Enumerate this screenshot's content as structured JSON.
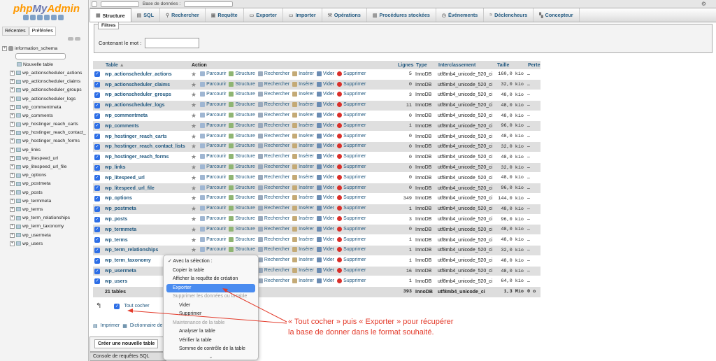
{
  "sidebar": {
    "logo_php": "php",
    "logo_my": "My",
    "logo_admin": "Admin",
    "tab_recent": "Récentes",
    "tab_favorites": "Préférées",
    "db_name": "information_schema",
    "new_table": "Nouvelle table",
    "tables": [
      "wp_actionscheduler_actions",
      "wp_actionscheduler_claims",
      "wp_actionscheduler_groups",
      "wp_actionscheduler_logs",
      "wp_commentmeta",
      "wp_comments",
      "wp_hostinger_reach_carts",
      "wp_hostinger_reach_contact_",
      "wp_hostinger_reach_forms",
      "wp_links",
      "wp_litespeed_url",
      "wp_litespeed_url_file",
      "wp_options",
      "wp_postmeta",
      "wp_posts",
      "wp_termmeta",
      "wp_terms",
      "wp_term_relationships",
      "wp_term_taxonomy",
      "wp_usermeta",
      "wp_users"
    ]
  },
  "topbar": {
    "db_label": "Base de données :"
  },
  "tabs": [
    {
      "label": "Structure",
      "icon": "structure-icon",
      "active": true
    },
    {
      "label": "SQL",
      "icon": "sql-icon"
    },
    {
      "label": "Rechercher",
      "icon": "search-icon"
    },
    {
      "label": "Requête",
      "icon": "query-icon"
    },
    {
      "label": "Exporter",
      "icon": "export-icon"
    },
    {
      "label": "Importer",
      "icon": "import-icon"
    },
    {
      "label": "Opérations",
      "icon": "wrench-icon"
    },
    {
      "label": "Procédures stockées",
      "icon": "routines-icon"
    },
    {
      "label": "Événements",
      "icon": "clock-icon"
    },
    {
      "label": "Déclencheurs",
      "icon": "triggers-icon"
    },
    {
      "label": "Concepteur",
      "icon": "designer-icon"
    }
  ],
  "filters": {
    "legend": "Filtres",
    "label": "Contenant le mot :",
    "value": ""
  },
  "table": {
    "headers": {
      "table": "Table",
      "action": "Action",
      "rows": "Lignes",
      "type": "Type",
      "collation": "Interclassement",
      "size": "Taille",
      "overhead": "Perte"
    },
    "actions": {
      "browse": "Parcourir",
      "structure": "Structure",
      "search": "Rechercher",
      "insert": "Insérer",
      "empty": "Vider",
      "drop": "Supprimer"
    },
    "rows": [
      {
        "name": "wp_actionscheduler_actions",
        "rows": "5",
        "type": "InnoDB",
        "collation": "utf8mb4_unicode_520_ci",
        "size": "160,0 kio",
        "overhead": "–"
      },
      {
        "name": "wp_actionscheduler_claims",
        "rows": "0",
        "type": "InnoDB",
        "collation": "utf8mb4_unicode_520_ci",
        "size": "32,0 kio",
        "overhead": "–"
      },
      {
        "name": "wp_actionscheduler_groups",
        "rows": "3",
        "type": "InnoDB",
        "collation": "utf8mb4_unicode_520_ci",
        "size": "48,0 kio",
        "overhead": "–"
      },
      {
        "name": "wp_actionscheduler_logs",
        "rows": "11",
        "type": "InnoDB",
        "collation": "utf8mb4_unicode_520_ci",
        "size": "48,0 kio",
        "overhead": "–"
      },
      {
        "name": "wp_commentmeta",
        "rows": "0",
        "type": "InnoDB",
        "collation": "utf8mb4_unicode_520_ci",
        "size": "48,0 kio",
        "overhead": "–"
      },
      {
        "name": "wp_comments",
        "rows": "1",
        "type": "InnoDB",
        "collation": "utf8mb4_unicode_520_ci",
        "size": "96,0 kio",
        "overhead": "–"
      },
      {
        "name": "wp_hostinger_reach_carts",
        "rows": "0",
        "type": "InnoDB",
        "collation": "utf8mb4_unicode_520_ci",
        "size": "48,0 kio",
        "overhead": "–"
      },
      {
        "name": "wp_hostinger_reach_contact_lists",
        "rows": "0",
        "type": "InnoDB",
        "collation": "utf8mb4_unicode_520_ci",
        "size": "32,0 kio",
        "overhead": "–"
      },
      {
        "name": "wp_hostinger_reach_forms",
        "rows": "0",
        "type": "InnoDB",
        "collation": "utf8mb4_unicode_520_ci",
        "size": "48,0 kio",
        "overhead": "–"
      },
      {
        "name": "wp_links",
        "rows": "0",
        "type": "InnoDB",
        "collation": "utf8mb4_unicode_520_ci",
        "size": "32,0 kio",
        "overhead": "–"
      },
      {
        "name": "wp_litespeed_url",
        "rows": "0",
        "type": "InnoDB",
        "collation": "utf8mb4_unicode_520_ci",
        "size": "48,0 kio",
        "overhead": "–"
      },
      {
        "name": "wp_litespeed_url_file",
        "rows": "0",
        "type": "InnoDB",
        "collation": "utf8mb4_unicode_520_ci",
        "size": "96,0 kio",
        "overhead": "–"
      },
      {
        "name": "wp_options",
        "rows": "349",
        "type": "InnoDB",
        "collation": "utf8mb4_unicode_520_ci",
        "size": "144,0 kio",
        "overhead": "–"
      },
      {
        "name": "wp_postmeta",
        "rows": "1",
        "type": "InnoDB",
        "collation": "utf8mb4_unicode_520_ci",
        "size": "48,0 kio",
        "overhead": "–"
      },
      {
        "name": "wp_posts",
        "rows": "3",
        "type": "InnoDB",
        "collation": "utf8mb4_unicode_520_ci",
        "size": "96,0 kio",
        "overhead": "–"
      },
      {
        "name": "wp_termmeta",
        "rows": "0",
        "type": "InnoDB",
        "collation": "utf8mb4_unicode_520_ci",
        "size": "48,0 kio",
        "overhead": "–"
      },
      {
        "name": "wp_terms",
        "rows": "1",
        "type": "InnoDB",
        "collation": "utf8mb4_unicode_520_ci",
        "size": "48,0 kio",
        "overhead": "–"
      },
      {
        "name": "wp_term_relationships",
        "rows": "1",
        "type": "InnoDB",
        "collation": "utf8mb4_unicode_520_ci",
        "size": "32,0 kio",
        "overhead": "–"
      },
      {
        "name": "wp_term_taxonomy",
        "rows": "1",
        "type": "InnoDB",
        "collation": "utf8mb4_unicode_520_ci",
        "size": "48,0 kio",
        "overhead": "–"
      },
      {
        "name": "wp_usermeta",
        "rows": "16",
        "type": "InnoDB",
        "collation": "utf8mb4_unicode_520_ci",
        "size": "48,0 kio",
        "overhead": "–"
      },
      {
        "name": "wp_users",
        "rows": "1",
        "type": "InnoDB",
        "collation": "utf8mb4_unicode_520_ci",
        "size": "64,0 kio",
        "overhead": "–"
      }
    ],
    "summary": {
      "count": "21 tables",
      "rows": "393",
      "type": "InnoDB",
      "collation": "utf8mb4_unicode_ci",
      "size": "1,3 Mio",
      "overhead": "0 o"
    }
  },
  "bulk": {
    "check_all": "Tout cocher"
  },
  "menu": {
    "items": [
      {
        "label": "✓ Avec la sélection :",
        "kind": "head"
      },
      {
        "label": "Copier la table",
        "kind": "normal"
      },
      {
        "label": "Afficher la requête de création",
        "kind": "normal"
      },
      {
        "label": "Exporter",
        "kind": "sel"
      },
      {
        "label": "Supprimer les données ou la table",
        "kind": "dis"
      },
      {
        "label": "Vider",
        "kind": "sub"
      },
      {
        "label": "Supprimer",
        "kind": "sub"
      },
      {
        "label": "Maintenance de la table",
        "kind": "dis"
      },
      {
        "label": "Analyser la table",
        "kind": "sub"
      },
      {
        "label": "Vérifier la table",
        "kind": "sub"
      },
      {
        "label": "Somme de contrôle de la table",
        "kind": "sub"
      }
    ],
    "more": "⌄"
  },
  "bottom": {
    "print": "Imprimer",
    "dictionary": "Dictionnaire de",
    "create_table": "Créer une nouvelle table",
    "console": "Console de requêtes SQL"
  },
  "annotation": {
    "line1": "« Tout cocher » puis « Exporter » pour récupérer",
    "line2": "la base de donner dans le format souhaité.",
    "color": "#e33b2b"
  }
}
